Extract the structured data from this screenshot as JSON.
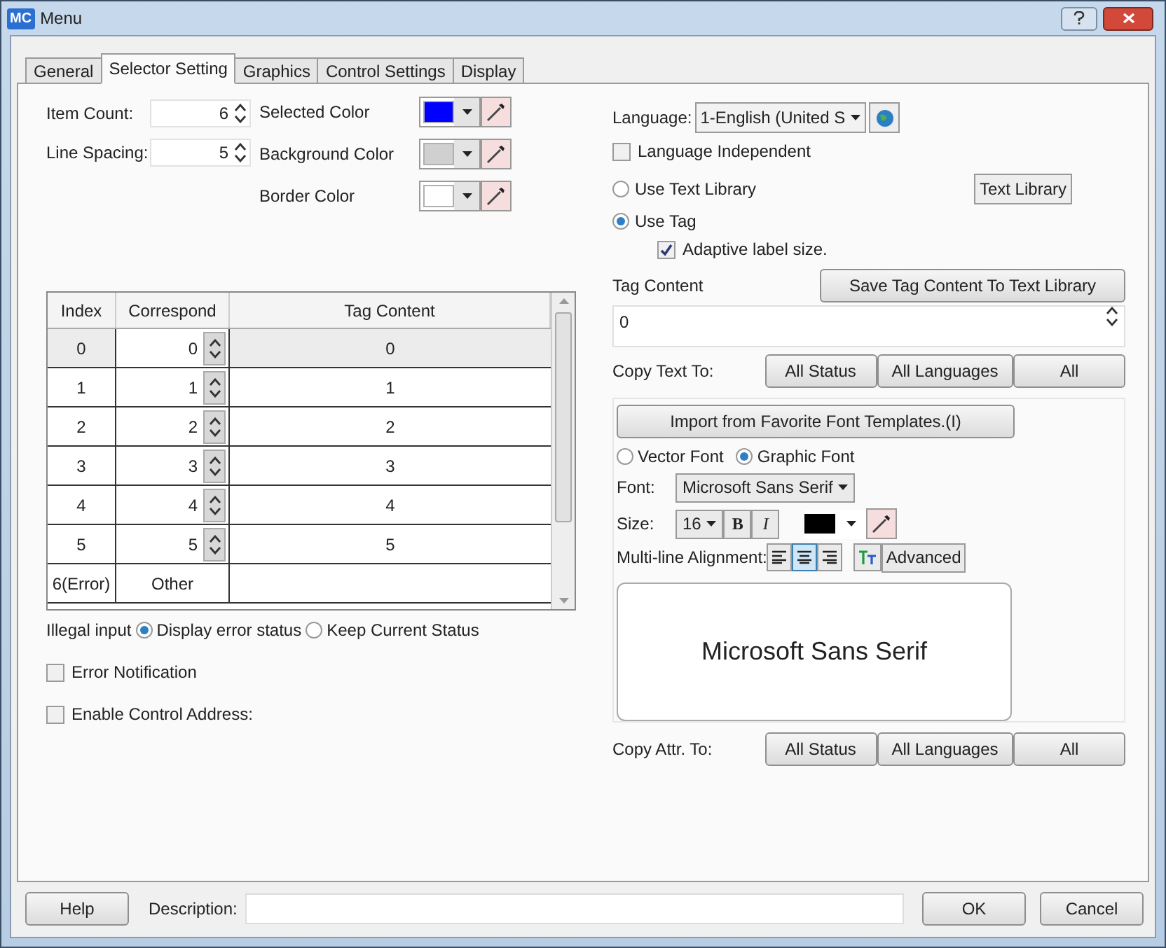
{
  "window": {
    "badge": "MC",
    "title": "Menu"
  },
  "tabs": [
    {
      "label": "General",
      "selected": false
    },
    {
      "label": "Selector Setting",
      "selected": true
    },
    {
      "label": "Graphics",
      "selected": false
    },
    {
      "label": "Control Settings",
      "selected": false
    },
    {
      "label": "Display",
      "selected": false
    }
  ],
  "spinners": [
    {
      "label": "Item Count:",
      "value": "6"
    },
    {
      "label": "Line Spacing:",
      "value": "5"
    }
  ],
  "colors": [
    {
      "label": "Selected Color",
      "color": "#0000ff"
    },
    {
      "label": "Background Color",
      "color": "#d0d0d0"
    },
    {
      "label": "Border Color",
      "color": "#ffffff"
    }
  ],
  "table": {
    "columns": [
      "Index",
      "Correspond",
      "Tag Content"
    ],
    "rows": [
      {
        "index": "0",
        "correspond": "0",
        "tag": "0",
        "selected": true,
        "kind": "spinner"
      },
      {
        "index": "1",
        "correspond": "1",
        "tag": "1",
        "selected": false,
        "kind": "spinner"
      },
      {
        "index": "2",
        "correspond": "2",
        "tag": "2",
        "selected": false,
        "kind": "spinner"
      },
      {
        "index": "3",
        "correspond": "3",
        "tag": "3",
        "selected": false,
        "kind": "spinner"
      },
      {
        "index": "4",
        "correspond": "4",
        "tag": "4",
        "selected": false,
        "kind": "spinner"
      },
      {
        "index": "5",
        "correspond": "5",
        "tag": "5",
        "selected": false,
        "kind": "spinner"
      },
      {
        "index": "6(Error)",
        "correspond": "Other",
        "selected": false,
        "kind": "text"
      }
    ]
  },
  "illegal_input": {
    "label": "Illegal input",
    "options": [
      {
        "label": "Display error status",
        "selected": true
      },
      {
        "label": "Keep Current Status",
        "selected": false
      }
    ]
  },
  "left_checkboxes": [
    {
      "label": "Error Notification",
      "checked": false
    },
    {
      "label": "Enable Control Address:",
      "checked": false
    }
  ],
  "language": {
    "label": "Language:",
    "value": "1-English (United S"
  },
  "language_independent": {
    "label": "Language Independent",
    "checked": false
  },
  "text_source": [
    {
      "label": "Use Text Library",
      "selected": false
    },
    {
      "label": "Use Tag",
      "selected": true
    }
  ],
  "text_library_button": "Text Library",
  "adaptive": {
    "label": "Adaptive label size.",
    "checked": true
  },
  "tag_content": {
    "label": "Tag Content",
    "save_button": "Save Tag Content To Text Library",
    "value": "0"
  },
  "copy_text": {
    "label": "Copy Text To:",
    "buttons": [
      "All Status",
      "All Languages",
      "All"
    ]
  },
  "import_button": "Import from Favorite Font Templates.(I)",
  "font_type": [
    {
      "label": "Vector Font",
      "selected": false
    },
    {
      "label": "Graphic Font",
      "selected": true
    }
  ],
  "font": {
    "label": "Font:",
    "value": "Microsoft Sans Serif"
  },
  "size": {
    "label": "Size:",
    "value": "16",
    "bold": "B",
    "italic": "I",
    "color": "#000000"
  },
  "alignment": {
    "label": "Multi-line Alignment:",
    "options": [
      {
        "selected": false
      },
      {
        "selected": true
      },
      {
        "selected": false
      }
    ],
    "advanced": "Advanced"
  },
  "preview": "Microsoft Sans Serif",
  "copy_attr": {
    "label": "Copy Attr. To:",
    "buttons": [
      "All Status",
      "All Languages",
      "All"
    ]
  },
  "footer": {
    "help": "Help",
    "description_label": "Description:",
    "ok": "OK",
    "cancel": "Cancel"
  }
}
